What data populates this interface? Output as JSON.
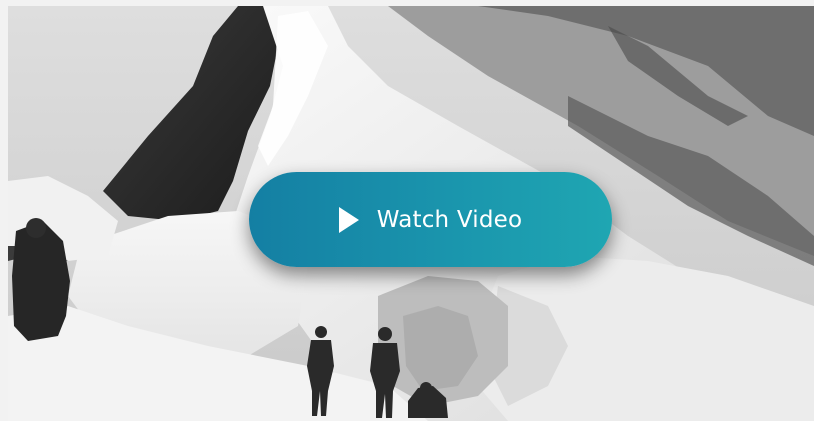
{
  "video_player": {
    "watch_label": "Watch Video",
    "play_icon": "play-icon",
    "button_color": "#1a8fab"
  }
}
